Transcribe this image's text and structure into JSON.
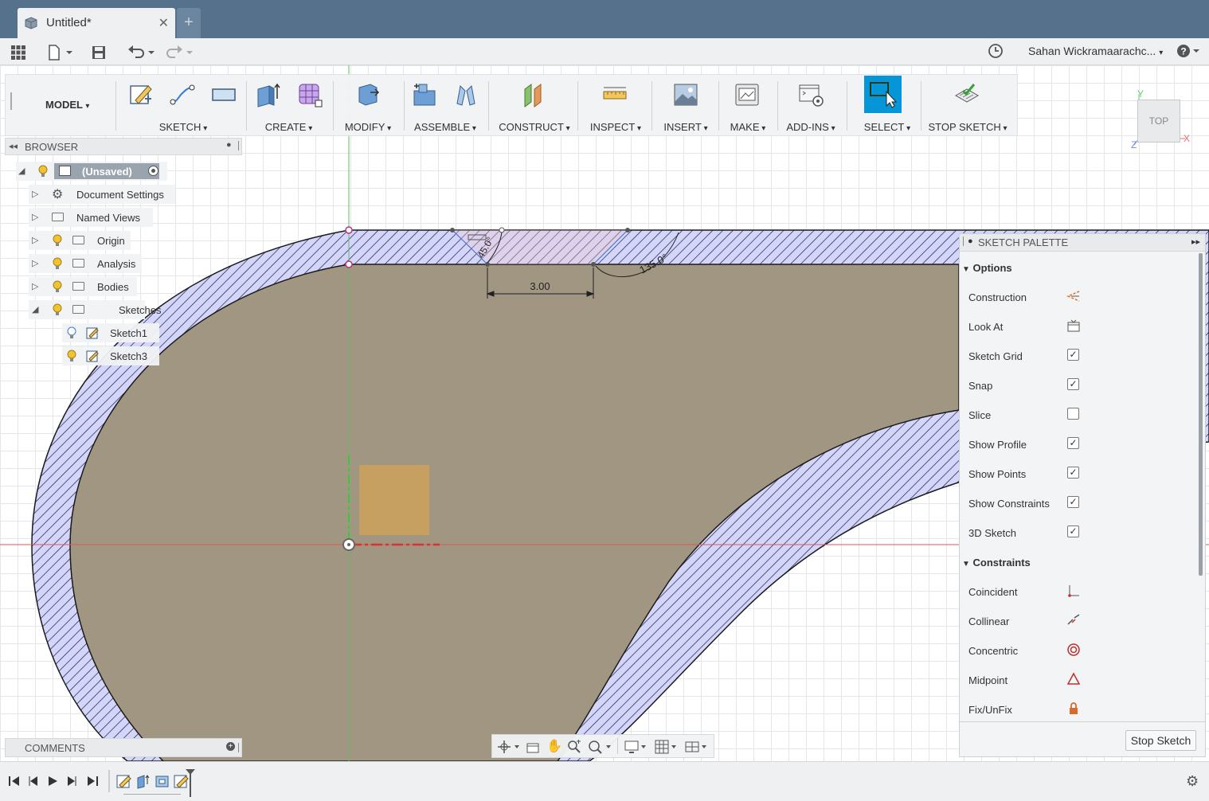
{
  "app": {
    "doc_tab_title": "Untitled*",
    "new_tab_label": "+"
  },
  "quick_access": {
    "user_name": "Sahan Wickramaarachc...",
    "help_label": "?"
  },
  "toolbar": {
    "workspace": "MODEL",
    "groups": [
      {
        "label": "SKETCH"
      },
      {
        "label": "CREATE"
      },
      {
        "label": "MODIFY"
      },
      {
        "label": "ASSEMBLE"
      },
      {
        "label": "CONSTRUCT"
      },
      {
        "label": "INSPECT"
      },
      {
        "label": "INSERT"
      },
      {
        "label": "MAKE"
      },
      {
        "label": "ADD-INS"
      },
      {
        "label": "SELECT"
      },
      {
        "label": "STOP SKETCH"
      }
    ]
  },
  "browser": {
    "title": "BROWSER",
    "root": "(Unsaved)",
    "items": [
      {
        "label": "Document Settings"
      },
      {
        "label": "Named Views"
      },
      {
        "label": "Origin"
      },
      {
        "label": "Analysis"
      },
      {
        "label": "Bodies"
      },
      {
        "label": "Sketches"
      }
    ],
    "sketches": [
      {
        "label": "Sketch1"
      },
      {
        "label": "Sketch3"
      }
    ]
  },
  "comments": {
    "title": "COMMENTS"
  },
  "viewcube": {
    "face": "TOP",
    "axis_x": "X",
    "axis_y": "Y",
    "axis_z": "Z"
  },
  "sketch": {
    "dim_length": "3.00",
    "dim_angle_right": "135.0°",
    "dim_angle_left": "45.0°"
  },
  "palette": {
    "title": "SKETCH PALETTE",
    "options_header": "Options",
    "options": [
      {
        "label": "Construction",
        "control": "construction-icon"
      },
      {
        "label": "Look At",
        "control": "look-at-icon"
      },
      {
        "label": "Sketch Grid",
        "checked": true
      },
      {
        "label": "Snap",
        "checked": true
      },
      {
        "label": "Slice",
        "checked": false
      },
      {
        "label": "Show Profile",
        "checked": true
      },
      {
        "label": "Show Points",
        "checked": true
      },
      {
        "label": "Show Constraints",
        "checked": true
      },
      {
        "label": "3D Sketch",
        "checked": true
      }
    ],
    "constraints_header": "Constraints",
    "constraints": [
      {
        "label": "Coincident",
        "icon": "coincident-icon"
      },
      {
        "label": "Collinear",
        "icon": "collinear-icon"
      },
      {
        "label": "Concentric",
        "icon": "concentric-icon"
      },
      {
        "label": "Midpoint",
        "icon": "midpoint-icon"
      },
      {
        "label": "Fix/UnFix",
        "icon": "lock-icon"
      }
    ],
    "stop_button": "Stop Sketch"
  }
}
